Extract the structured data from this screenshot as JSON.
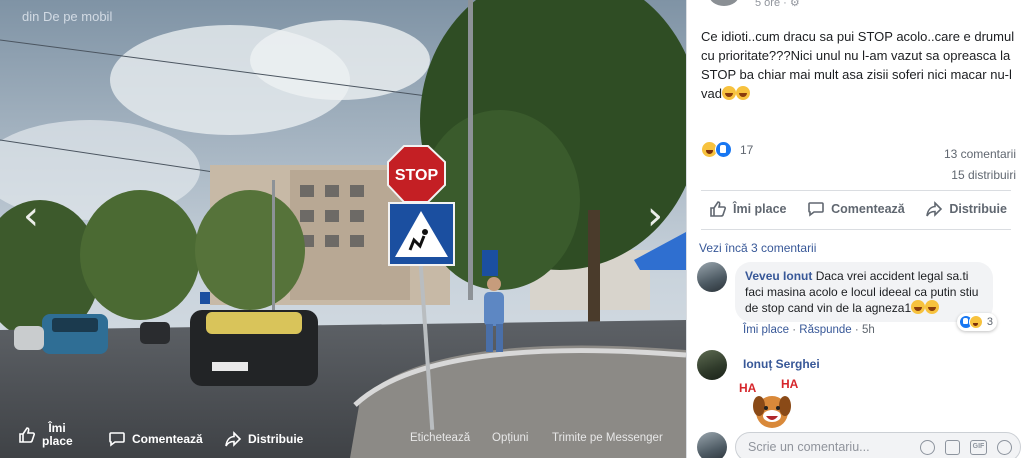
{
  "viewer": {
    "title": "",
    "subtitle": "din De pe mobil",
    "bottom_bar": {
      "like_label": "Îmi place",
      "comment_label": "Comentează",
      "share_label": "Distribuie",
      "tag_label": "Etichetează",
      "options_label": "Opțiuni",
      "messenger_label": "Trimite pe Messenger"
    }
  },
  "post": {
    "time": "5 ore",
    "text": "Ce idioti..cum dracu sa pui STOP acolo..care e drumul cu prioritate???Nici unul nu l-am vazut sa opreasca la STOP ba chiar mai mult asa zisii soferi nici macar nu-l vad",
    "reaction_count": "17",
    "comments_count": "13 comentarii",
    "shares_count": "15 distribuiri",
    "actions": {
      "like": "Îmi place",
      "comment": "Comentează",
      "share": "Distribuie"
    },
    "more_comments": "Vezi încă 3 comentarii"
  },
  "comments": [
    {
      "author": "Veveu Ionut",
      "text": "Daca vrei accident legal sa.ti faci masina acolo e locul ideeal ca putin stiu de stop cand vin de la agneza1",
      "like_label": "Îmi place",
      "reply_label": "Răspunde",
      "time": "5h",
      "reactions": "3"
    },
    {
      "author": "Ionuț Serghei",
      "sticker_text": "HA HA"
    }
  ],
  "composer": {
    "placeholder": "Scrie un comentariu..."
  },
  "icons": [
    "chevron-left-icon",
    "chevron-right-icon",
    "like-icon",
    "comment-icon",
    "share-icon",
    "emoji-icon",
    "camera-icon",
    "gif-icon",
    "sticker-icon"
  ],
  "colors": {
    "link": "#385898",
    "like_blue": "#1877f2",
    "haha_yellow": "#f7c23e",
    "muted": "#606770"
  }
}
